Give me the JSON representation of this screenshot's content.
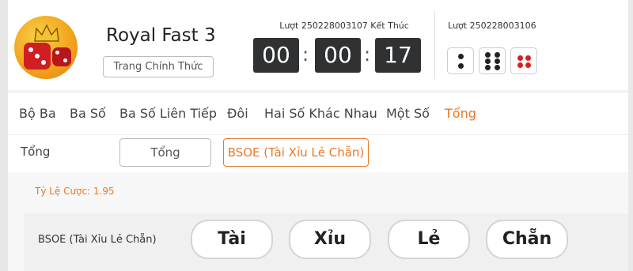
{
  "game": {
    "title": "Royal Fast 3",
    "official_label": "Trang Chính Thức"
  },
  "current_round": {
    "label": "Lượt 250228003107 Kết Thúc",
    "hours": "00",
    "minutes": "00",
    "seconds": "17"
  },
  "previous_round": {
    "label": "Lượt 250228003106",
    "dice": [
      2,
      6,
      4
    ]
  },
  "tabs": [
    {
      "label": "Bộ Ba",
      "active": false
    },
    {
      "label": "Ba Số",
      "active": false
    },
    {
      "label": "Ba Số Liên Tiếp",
      "active": false
    },
    {
      "label": "Đôi",
      "active": false
    },
    {
      "label": "Hai Số Khác Nhau",
      "active": false
    },
    {
      "label": "Một Số",
      "active": false
    },
    {
      "label": "Tổng",
      "active": true
    }
  ],
  "subnav": {
    "label": "Tổng",
    "options": [
      "Tổng",
      "BSOE (Tài Xỉu Lẻ Chẵn)"
    ],
    "selected": "BSOE (Tài Xỉu Lẻ Chẵn)"
  },
  "odds": {
    "label": "Tỷ Lệ Cược: 1.95"
  },
  "bet": {
    "label": "BSOE (Tài Xỉu Lẻ Chẵn)",
    "options": [
      "Tài",
      "Xỉu",
      "Lẻ",
      "Chẵn"
    ]
  },
  "colors": {
    "accent": "#e8792a",
    "timer_bg": "#2f3133",
    "red_pip": "#d82121"
  }
}
